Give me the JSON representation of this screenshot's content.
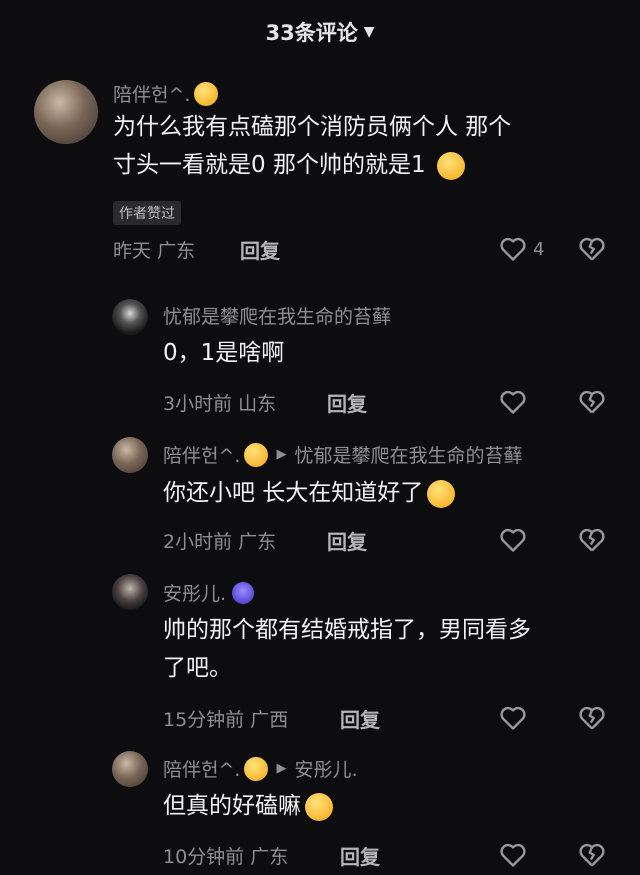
{
  "header": {
    "title": "33条评论"
  },
  "comments": [
    {
      "name": "陪伴헌^.",
      "text_line1": "为什么我有点磕那个消防员俩个人 那个",
      "text_line2": "寸头一看就是0 那个帅的就是1",
      "tag": "作者赞过",
      "time": "昨天",
      "location": "广东",
      "reply": "回复",
      "likes": "4"
    },
    {
      "name": "忧郁是攀爬在我生命的苔藓",
      "text": "0，1是啥啊",
      "time": "3小时前",
      "location": "山东",
      "reply": "回复"
    },
    {
      "name": "陪伴헌^.",
      "reply_to": "忧郁是攀爬在我生命的苔藓",
      "text": "你还小吧 长大在知道好了",
      "time": "2小时前",
      "location": "广东",
      "reply": "回复"
    },
    {
      "name": "安彤儿.",
      "text_line1": "帅的那个都有结婚戒指了，男同看多",
      "text_line2": "了吧。",
      "time": "15分钟前",
      "location": "广西",
      "reply": "回复"
    },
    {
      "name": "陪伴헌^.",
      "reply_to": "安彤儿.",
      "text": "但真的好磕嘛",
      "time": "10分钟前",
      "location": "广东",
      "reply": "回复"
    }
  ],
  "icons": {
    "like": "heart-outline-icon",
    "dislike": "broken-heart-icon",
    "dropdown": "triangle-down-icon"
  }
}
